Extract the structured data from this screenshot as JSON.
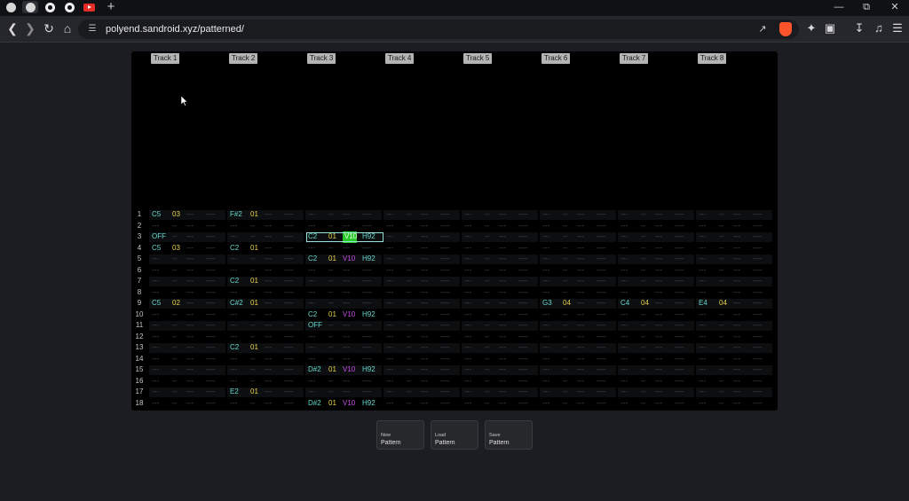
{
  "browser": {
    "url": "polyend.sandroid.xyz/patterned/",
    "new_tab_label": "+",
    "tabs": [
      "globe-icon",
      "globe-icon",
      "github-icon",
      "github-icon",
      "youtube-icon"
    ]
  },
  "tracks": [
    "Track 1",
    "Track 2",
    "Track 3",
    "Track 4",
    "Track 5",
    "Track 6",
    "Track 7",
    "Track 8"
  ],
  "empty": {
    "note": "---",
    "inst": "--",
    "vol": "---",
    "fx": "----"
  },
  "rows": [
    {
      "num": "1",
      "cells": [
        {
          "note": "C5",
          "inst": "03"
        },
        {
          "note": "F#2",
          "inst": "01"
        },
        {},
        {},
        {},
        {},
        {},
        {}
      ]
    },
    {
      "num": "2",
      "cells": [
        {},
        {},
        {},
        {},
        {},
        {},
        {},
        {}
      ]
    },
    {
      "num": "3",
      "cells": [
        {
          "note": "OFF"
        },
        {},
        {
          "note": "C2",
          "inst": "01",
          "vol": "V10",
          "fx": "H92",
          "selected": true
        },
        {},
        {},
        {},
        {},
        {}
      ]
    },
    {
      "num": "4",
      "cells": [
        {
          "note": "C5",
          "inst": "03"
        },
        {
          "note": "C2",
          "inst": "01"
        },
        {},
        {},
        {},
        {},
        {},
        {}
      ]
    },
    {
      "num": "5",
      "cells": [
        {},
        {},
        {
          "note": "C2",
          "inst": "01",
          "vol": "V10",
          "fx": "H92"
        },
        {},
        {},
        {},
        {},
        {}
      ]
    },
    {
      "num": "6",
      "cells": [
        {},
        {},
        {},
        {},
        {},
        {},
        {},
        {}
      ]
    },
    {
      "num": "7",
      "cells": [
        {},
        {
          "note": "C2",
          "inst": "01"
        },
        {},
        {},
        {},
        {},
        {},
        {}
      ]
    },
    {
      "num": "8",
      "cells": [
        {},
        {},
        {},
        {},
        {},
        {},
        {},
        {}
      ]
    },
    {
      "num": "9",
      "cells": [
        {
          "note": "C5",
          "inst": "02"
        },
        {
          "note": "C#2",
          "inst": "01"
        },
        {},
        {},
        {},
        {
          "note": "G3",
          "inst": "04"
        },
        {
          "note": "C4",
          "inst": "04"
        },
        {
          "note": "E4",
          "inst": "04"
        }
      ]
    },
    {
      "num": "10",
      "cells": [
        {},
        {},
        {
          "note": "C2",
          "inst": "01",
          "vol": "V10",
          "fx": "H92"
        },
        {},
        {},
        {},
        {},
        {}
      ]
    },
    {
      "num": "11",
      "cells": [
        {},
        {},
        {
          "note": "OFF"
        },
        {},
        {},
        {},
        {},
        {}
      ]
    },
    {
      "num": "12",
      "cells": [
        {},
        {},
        {},
        {},
        {},
        {},
        {},
        {}
      ]
    },
    {
      "num": "13",
      "cells": [
        {},
        {
          "note": "C2",
          "inst": "01"
        },
        {},
        {},
        {},
        {},
        {},
        {}
      ]
    },
    {
      "num": "14",
      "cells": [
        {},
        {},
        {},
        {},
        {},
        {},
        {},
        {}
      ]
    },
    {
      "num": "15",
      "cells": [
        {},
        {},
        {
          "note": "D#2",
          "inst": "01",
          "vol": "V10",
          "fx": "H92"
        },
        {},
        {},
        {},
        {},
        {}
      ]
    },
    {
      "num": "16",
      "cells": [
        {},
        {},
        {},
        {},
        {},
        {},
        {},
        {}
      ]
    },
    {
      "num": "17",
      "cells": [
        {},
        {
          "note": "E2",
          "inst": "01"
        },
        {},
        {},
        {},
        {},
        {},
        {}
      ]
    },
    {
      "num": "18",
      "cells": [
        {},
        {},
        {
          "note": "D#2",
          "inst": "01",
          "vol": "V10",
          "fx": "H92"
        },
        {},
        {},
        {},
        {},
        {}
      ]
    }
  ],
  "buttons": [
    {
      "line1": "New",
      "line2": "Pattern"
    },
    {
      "line1": "Load",
      "line2": "Pattern"
    },
    {
      "line1": "Save",
      "line2": "Pattern"
    }
  ],
  "colors": {
    "note": "#63d9cf",
    "instrument": "#e8d24a",
    "volume": "#c64be6",
    "selected_volume": "#28c928"
  }
}
